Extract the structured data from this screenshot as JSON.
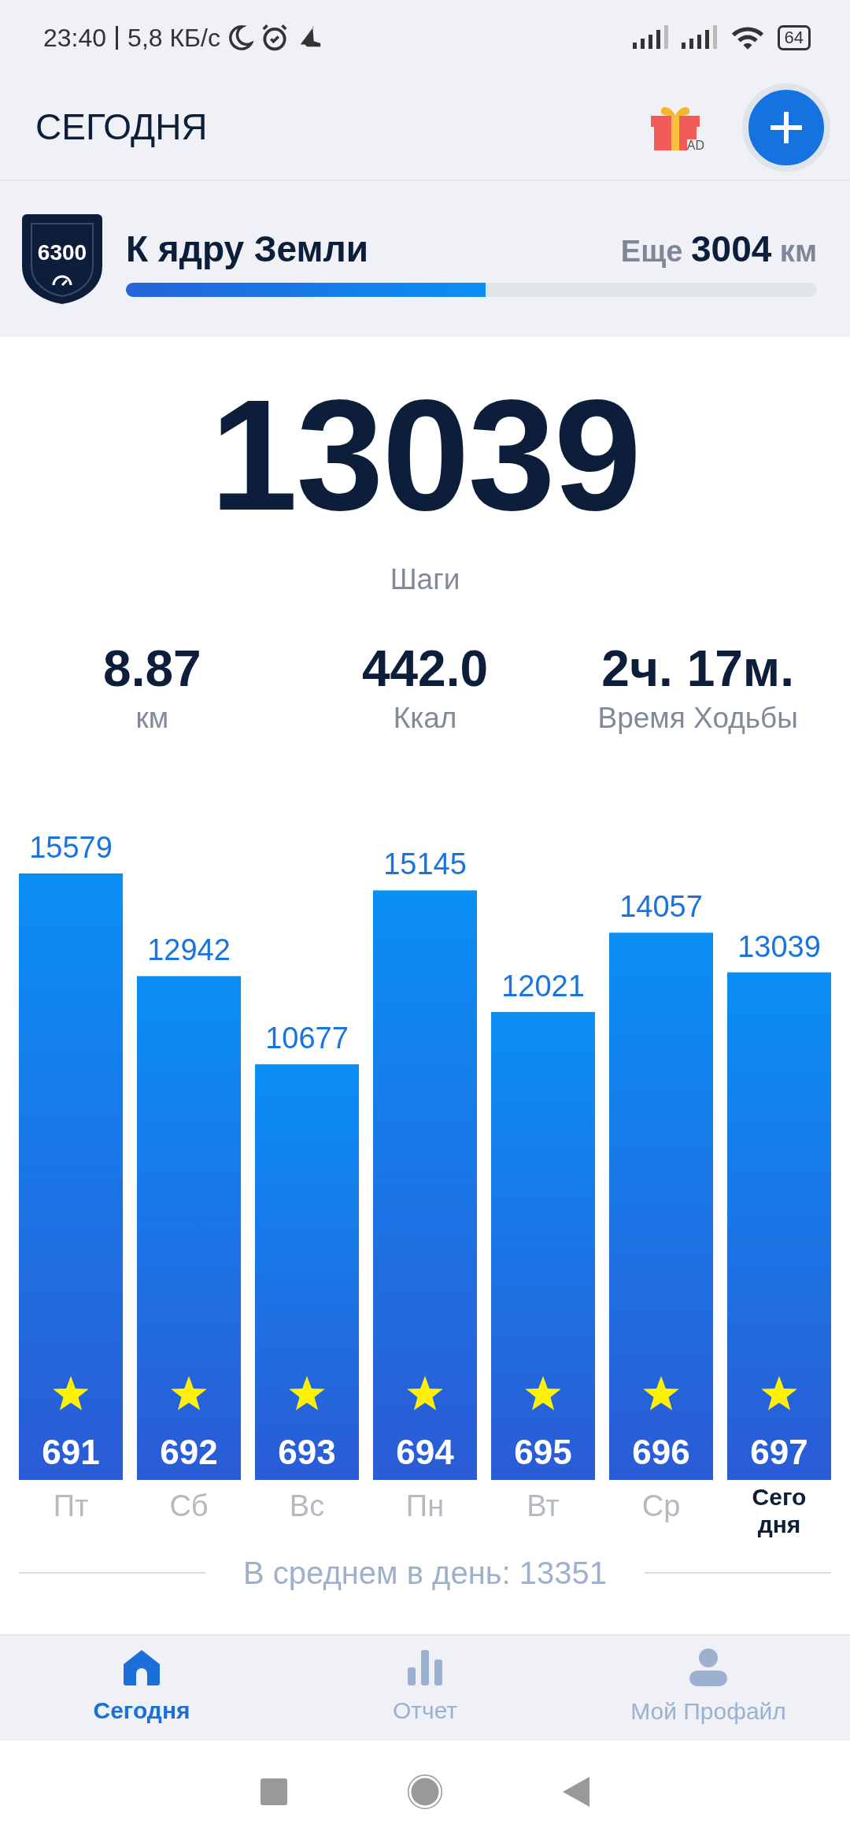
{
  "status_bar": {
    "time": "23:40",
    "speed": "5,8 КБ/с",
    "battery": "64"
  },
  "header": {
    "title": "СЕГОДНЯ",
    "ad_label": "AD"
  },
  "goal": {
    "badge": "6300",
    "title": "К ядру Земли",
    "remaining_prefix": "Еще",
    "remaining_value": "3004",
    "remaining_unit": "км",
    "level": 0.52
  },
  "steps": {
    "value": "13039",
    "label": "Шаги"
  },
  "stats": [
    {
      "value": "8.87",
      "label": "км"
    },
    {
      "value": "442.0",
      "label": "Ккал"
    },
    {
      "value": "2ч. 17м.",
      "label": "Время Ходьбы"
    }
  ],
  "chart_data": {
    "type": "bar",
    "categories": [
      "Пт",
      "Сб",
      "Вс",
      "Пн",
      "Вт",
      "Ср",
      "Сегодня"
    ],
    "values": [
      15579,
      12942,
      10677,
      15145,
      12021,
      14057,
      13039
    ],
    "data_labels": true
  },
  "bar_details": [
    {
      "number": "691",
      "starred": true,
      "current": false
    },
    {
      "number": "692",
      "starred": true,
      "current": false
    },
    {
      "number": "693",
      "starred": true,
      "current": false
    },
    {
      "number": "694",
      "starred": true,
      "current": false
    },
    {
      "number": "695",
      "starred": true,
      "current": false
    },
    {
      "number": "696",
      "starred": true,
      "current": false
    },
    {
      "number": "697",
      "starred": true,
      "current": true
    }
  ],
  "average": "В среднем в день: 13351",
  "bottom_nav": [
    {
      "label": "Сегодня",
      "selected": true
    },
    {
      "label": "Отчет",
      "selected": false
    },
    {
      "label": "Мой Профайл",
      "selected": false
    }
  ]
}
